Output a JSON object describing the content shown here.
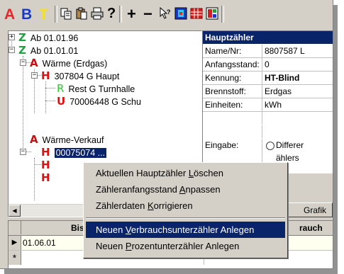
{
  "toolbar": {
    "letters": [
      {
        "label": "A",
        "color": "#e8262a"
      },
      {
        "label": "B",
        "color": "#1838c8"
      },
      {
        "label": "T",
        "color": "#f2e12a"
      }
    ],
    "icons": [
      "copy-icon",
      "paste-icon",
      "print-icon",
      "help-icon",
      "add-icon",
      "remove-icon",
      "context-help-icon",
      "color-icon",
      "table-icon",
      "report-icon"
    ],
    "add_label": "+",
    "remove_label": "−",
    "help_label": "?",
    "context_help_label": "⁇"
  },
  "tree": {
    "nodes": [
      {
        "glyph": "Z",
        "color": "#20a040",
        "label": "Ab 01.01.96"
      },
      {
        "glyph": "Z",
        "color": "#20a040",
        "label": "Ab 01.01.01"
      },
      {
        "glyph": "A",
        "color": "#c81010",
        "label": "Wärme (Erdgas)"
      },
      {
        "glyph": "H",
        "color": "#e01010",
        "label": "307804 G Haupt"
      },
      {
        "glyph": "R",
        "color": "#30c830",
        "label": "Rest G Turnhalle"
      },
      {
        "glyph": "U",
        "color": "#e01010",
        "label": "70006448 G Schu"
      },
      {
        "glyph": "A",
        "color": "#c81010",
        "label": "Wärme-Verkauf"
      },
      {
        "glyph": "H",
        "color": "#e01010",
        "label": "00075074 ..."
      },
      {
        "glyph": "H",
        "color": "#e01010",
        "label": ""
      },
      {
        "glyph": "H",
        "color": "#e01010",
        "label": ""
      }
    ]
  },
  "properties": {
    "header": "Hauptzähler",
    "rows": [
      {
        "key": "Name/Nr:",
        "value": "8807587 L"
      },
      {
        "key": "Anfangsstand:",
        "value": "0"
      },
      {
        "key": "Kennung:",
        "value": "HT-Blind"
      },
      {
        "key": "Brennstoff:",
        "value": "Erdgas"
      },
      {
        "key": "Einheiten:",
        "value": "kWh"
      }
    ],
    "eingabe_label": "Eingabe:",
    "radio_text": "Differer",
    "radio_text2": "ählers",
    "grafik_label": "Grafik"
  },
  "grid": {
    "col1": "Bis",
    "col2": "rauch",
    "row1_date": "01.06.01",
    "new_row_marker": "*",
    "current_row_marker": "▶"
  },
  "context_menu": {
    "items": [
      {
        "text": "Aktuellen Hauptzähler Löschen",
        "ul": "L"
      },
      {
        "text": "Zähleranfangsstand Anpassen",
        "ul": "A"
      },
      {
        "text": "Zählerdaten Korrigieren",
        "ul": "K"
      },
      {
        "text": "Neuen Verbrauchsunterzähler Anlegen",
        "ul": "V"
      },
      {
        "text": "Neuen Prozentunterzähler Anlegen",
        "ul": "P"
      }
    ]
  }
}
